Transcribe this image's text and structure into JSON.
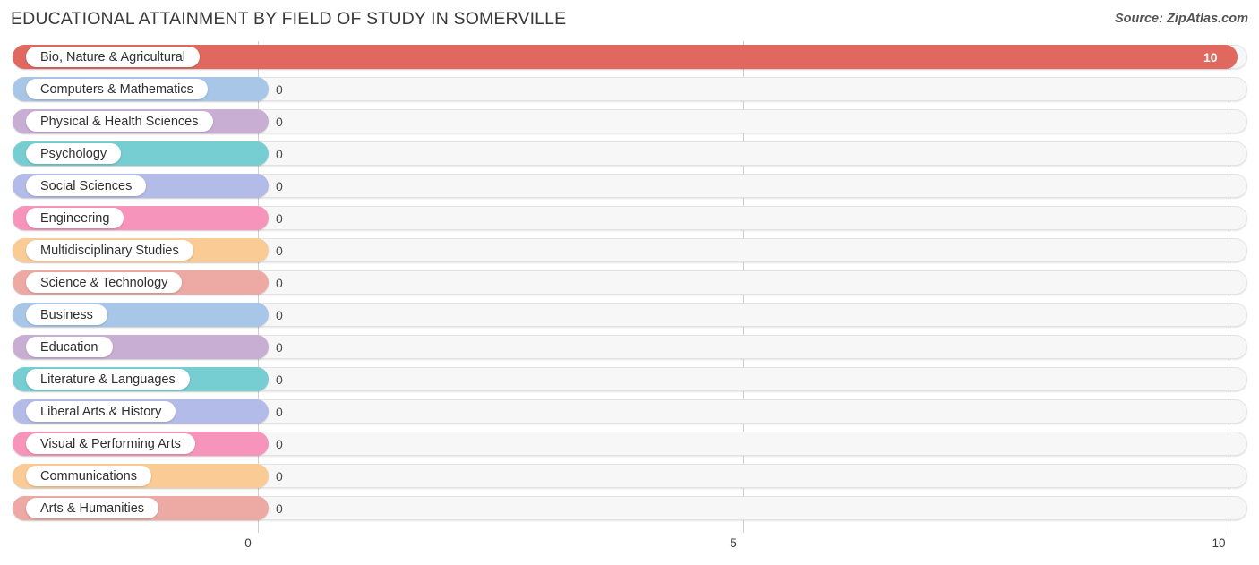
{
  "header": {
    "title": "EDUCATIONAL ATTAINMENT BY FIELD OF STUDY IN SOMERVILLE",
    "source": "Source: ZipAtlas.com"
  },
  "chart_data": {
    "type": "bar",
    "orientation": "horizontal",
    "title": "EDUCATIONAL ATTAINMENT BY FIELD OF STUDY IN SOMERVILLE",
    "subtitle": "",
    "xlabel": "",
    "ylabel": "",
    "xlim": [
      0,
      10
    ],
    "xticks": [
      0,
      5,
      10
    ],
    "xtick_labels": [
      "0",
      "5",
      "10"
    ],
    "grid": true,
    "legend": false,
    "categories": [
      "Bio, Nature & Agricultural",
      "Computers & Mathematics",
      "Physical & Health Sciences",
      "Psychology",
      "Social Sciences",
      "Engineering",
      "Multidisciplinary Studies",
      "Science & Technology",
      "Business",
      "Education",
      "Literature & Languages",
      "Liberal Arts & History",
      "Visual & Performing Arts",
      "Communications",
      "Arts & Humanities"
    ],
    "values": [
      10,
      0,
      0,
      0,
      0,
      0,
      0,
      0,
      0,
      0,
      0,
      0,
      0,
      0,
      0
    ],
    "value_labels": [
      "10",
      "0",
      "0",
      "0",
      "0",
      "0",
      "0",
      "0",
      "0",
      "0",
      "0",
      "0",
      "0",
      "0",
      "0"
    ],
    "bar_colors": [
      "#e0685f",
      "#a8c6e8",
      "#c9aed4",
      "#76cdd2",
      "#b3bbe8",
      "#f794bb",
      "#fbcb95",
      "#eda9a3",
      "#a8c6e8",
      "#c9aed4",
      "#76cdd2",
      "#b3bbe8",
      "#f794bb",
      "#fbcb95",
      "#eda9a3"
    ]
  },
  "colors": {
    "track_fill": "#f7f7f7",
    "track_border": "#e3e3e3",
    "gridline": "#cfcfcf",
    "title_text": "#3a3a3a",
    "source_text": "#555555"
  }
}
